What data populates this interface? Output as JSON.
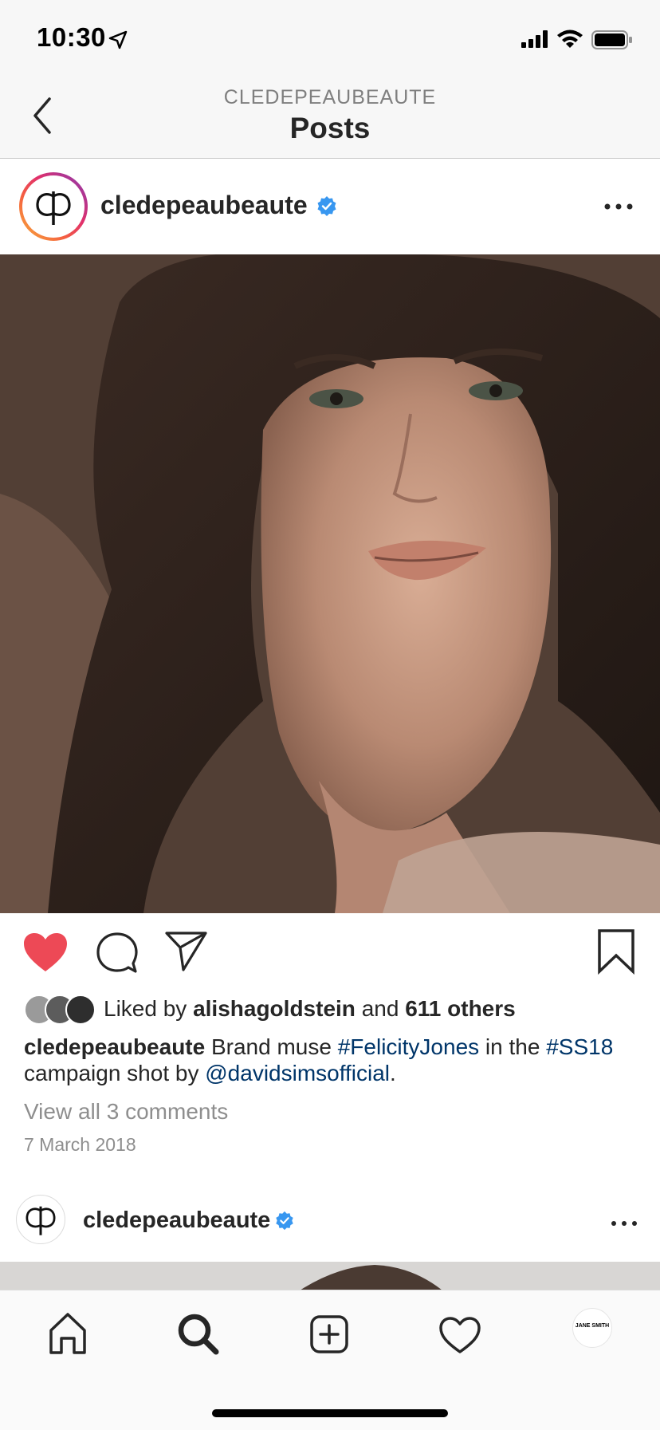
{
  "status_bar": {
    "time": "10:30"
  },
  "nav": {
    "subtitle": "CLEDEPEAUBEAUTE",
    "title": "Posts"
  },
  "post": {
    "username": "cledepeaubeaute",
    "likes": {
      "prefix": "Liked by",
      "user": "alishagoldstein",
      "conj": "and",
      "others": "611 others"
    },
    "caption": {
      "username": "cledepeaubeaute",
      "text1": "Brand muse",
      "hashtag1": "#FelicityJones",
      "text2": "in the",
      "hashtag2": "#SS18",
      "text3": "campaign shot by",
      "mention": "@davidsimsofficial",
      "end": "."
    },
    "view_comments": "View all 3 comments",
    "date": "7 March 2018",
    "liked": true
  },
  "post2": {
    "username": "cledepeaubeaute"
  },
  "tab_bar": {
    "profile_label": "JANE SMITH",
    "active": "search"
  },
  "colors": {
    "heart": "#ed4956",
    "verified": "#3897f0",
    "link": "#003569",
    "muted": "#8e8e8e"
  }
}
